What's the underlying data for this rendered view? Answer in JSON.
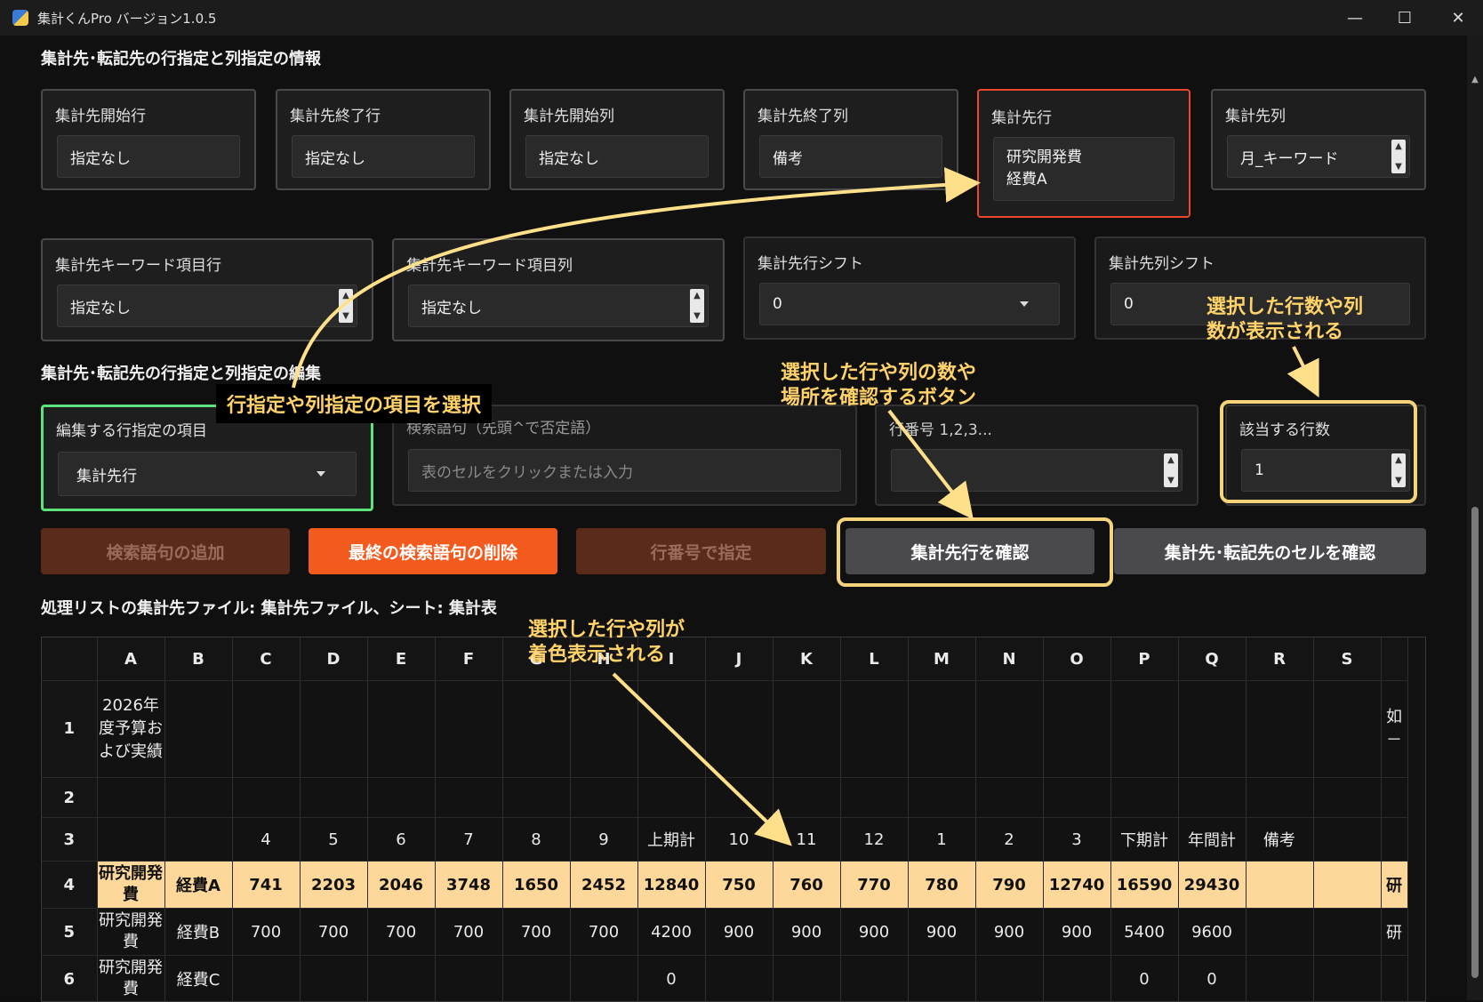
{
  "window": {
    "title": "集計くんPro バージョン1.0.5",
    "minimize": "—",
    "maximize": "☐",
    "close": "✕"
  },
  "section1": {
    "title": "集計先･転記先の行指定と列指定の情報"
  },
  "cards_row1": [
    {
      "label": "集計先開始行",
      "value": "指定なし"
    },
    {
      "label": "集計先終了行",
      "value": "指定なし"
    },
    {
      "label": "集計先開始列",
      "value": "指定なし"
    },
    {
      "label": "集計先終了列",
      "value": "備考"
    },
    {
      "label": "集計先行",
      "value_lines": [
        "研究開発費",
        "経費A"
      ]
    },
    {
      "label": "集計先列",
      "value": "月_キーワード"
    }
  ],
  "cards_row2": [
    {
      "label": "集計先キーワード項目行",
      "value": "指定なし"
    },
    {
      "label": "集計先キーワード項目列",
      "value": "指定なし"
    },
    {
      "label": "集計先行シフト",
      "value": "0"
    },
    {
      "label": "集計先列シフト",
      "value": "0"
    }
  ],
  "section2": {
    "title": "集計先･転記先の行指定と列指定の編集"
  },
  "edit": {
    "item_label": "編集する行指定の項目",
    "item_value": "集計先行",
    "search_label": "検索語句（先頭^で否定語）",
    "search_placeholder": "表のセルをクリックまたは入力",
    "rownum_label": "行番号 1,2,3...",
    "count_label": "該当する行数",
    "count_value": "1"
  },
  "buttons": {
    "add": "検索語句の追加",
    "delete_last": "最終の検索語句の削除",
    "by_rownum": "行番号で指定",
    "confirm_row": "集計先行を確認",
    "confirm_cell": "集計先･転記先のセルを確認"
  },
  "list_title": "処理リストの集計先ファイル: 集計先ファイル、シート: 集計表",
  "annotations": {
    "select_item": "行指定や列指定の項目を選択",
    "count_shown_1": "選択した行数や列",
    "count_shown_2": "数が表示される",
    "confirm_btn_1": "選択した行や列の数や",
    "confirm_btn_2": "場所を確認するボタン",
    "colored_1": "選択した行や列が",
    "colored_2": "着色表示される"
  },
  "colors": {
    "accent_orange": "#f25a1e",
    "highlight_red": "#e8472b",
    "highlight_green": "#5ee27a",
    "annotation_yellow": "#ffd36a",
    "selected_row": "#fdd89a"
  },
  "sheet": {
    "columns": [
      "A",
      "B",
      "C",
      "D",
      "E",
      "F",
      "G",
      "H",
      "I",
      "J",
      "K",
      "L",
      "M",
      "N",
      "O",
      "P",
      "Q",
      "R",
      "S",
      ""
    ],
    "rows": [
      {
        "num": "1",
        "cells": [
          "2026年度予算および実績",
          "",
          "",
          "",
          "",
          "",
          "",
          "",
          "",
          "",
          "",
          "",
          "",
          "",
          "",
          "",
          "",
          "",
          "",
          "如\n－"
        ]
      },
      {
        "num": "2",
        "cells": [
          "",
          "",
          "",
          "",
          "",
          "",
          "",
          "",
          "",
          "",
          "",
          "",
          "",
          "",
          "",
          "",
          "",
          "",
          "",
          ""
        ]
      },
      {
        "num": "3",
        "cells": [
          "",
          "",
          "4",
          "5",
          "6",
          "7",
          "8",
          "9",
          "上期計",
          "10",
          "11",
          "12",
          "1",
          "2",
          "3",
          "下期計",
          "年間計",
          "備考",
          "",
          ""
        ]
      },
      {
        "num": "4",
        "cells": [
          "研究開発費",
          "経費A",
          "741",
          "2203",
          "2046",
          "3748",
          "1650",
          "2452",
          "12840",
          "750",
          "760",
          "770",
          "780",
          "790",
          "12740",
          "16590",
          "29430",
          "",
          "",
          "研"
        ]
      },
      {
        "num": "5",
        "cells": [
          "研究開発費",
          "経費B",
          "700",
          "700",
          "700",
          "700",
          "700",
          "700",
          "4200",
          "900",
          "900",
          "900",
          "900",
          "900",
          "900",
          "5400",
          "9600",
          "",
          "",
          "研"
        ]
      },
      {
        "num": "6",
        "cells": [
          "研究開発費",
          "経費C",
          "",
          "",
          "",
          "",
          "",
          "",
          "0",
          "",
          "",
          "",
          "",
          "",
          "",
          "0",
          "0",
          "",
          "",
          ""
        ]
      }
    ]
  }
}
